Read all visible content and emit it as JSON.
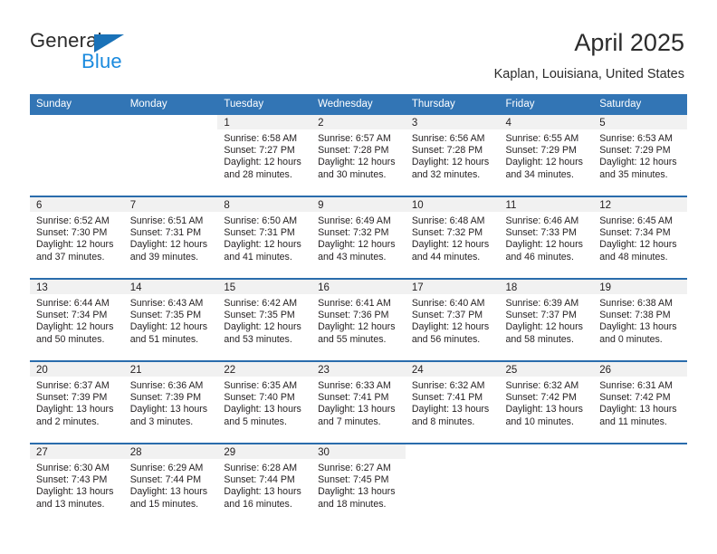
{
  "brand": {
    "name_part1": "General",
    "name_part2": "Blue",
    "triangle_color": "#1a72b8",
    "blue_color": "#1a8ade"
  },
  "header": {
    "title": "April 2025",
    "subtitle": "Kaplan, Louisiana, United States"
  },
  "theme": {
    "header_blue": "#3275b5",
    "row_divider_blue": "#2a6cac",
    "daynum_band": "#f1f1f1"
  },
  "weekday_headers": [
    "Sunday",
    "Monday",
    "Tuesday",
    "Wednesday",
    "Thursday",
    "Friday",
    "Saturday"
  ],
  "labels": {
    "sunrise_prefix": "Sunrise:",
    "sunset_prefix": "Sunset:",
    "daylight_prefix": "Daylight:"
  },
  "weeks": [
    [
      {
        "day": "",
        "blank": true
      },
      {
        "day": "",
        "blank": true
      },
      {
        "day": "1",
        "sunrise": "Sunrise: 6:58 AM",
        "sunset": "Sunset: 7:27 PM",
        "daylight_l1": "Daylight: 12 hours",
        "daylight_l2": "and 28 minutes."
      },
      {
        "day": "2",
        "sunrise": "Sunrise: 6:57 AM",
        "sunset": "Sunset: 7:28 PM",
        "daylight_l1": "Daylight: 12 hours",
        "daylight_l2": "and 30 minutes."
      },
      {
        "day": "3",
        "sunrise": "Sunrise: 6:56 AM",
        "sunset": "Sunset: 7:28 PM",
        "daylight_l1": "Daylight: 12 hours",
        "daylight_l2": "and 32 minutes."
      },
      {
        "day": "4",
        "sunrise": "Sunrise: 6:55 AM",
        "sunset": "Sunset: 7:29 PM",
        "daylight_l1": "Daylight: 12 hours",
        "daylight_l2": "and 34 minutes."
      },
      {
        "day": "5",
        "sunrise": "Sunrise: 6:53 AM",
        "sunset": "Sunset: 7:29 PM",
        "daylight_l1": "Daylight: 12 hours",
        "daylight_l2": "and 35 minutes."
      }
    ],
    [
      {
        "day": "6",
        "sunrise": "Sunrise: 6:52 AM",
        "sunset": "Sunset: 7:30 PM",
        "daylight_l1": "Daylight: 12 hours",
        "daylight_l2": "and 37 minutes."
      },
      {
        "day": "7",
        "sunrise": "Sunrise: 6:51 AM",
        "sunset": "Sunset: 7:31 PM",
        "daylight_l1": "Daylight: 12 hours",
        "daylight_l2": "and 39 minutes."
      },
      {
        "day": "8",
        "sunrise": "Sunrise: 6:50 AM",
        "sunset": "Sunset: 7:31 PM",
        "daylight_l1": "Daylight: 12 hours",
        "daylight_l2": "and 41 minutes."
      },
      {
        "day": "9",
        "sunrise": "Sunrise: 6:49 AM",
        "sunset": "Sunset: 7:32 PM",
        "daylight_l1": "Daylight: 12 hours",
        "daylight_l2": "and 43 minutes."
      },
      {
        "day": "10",
        "sunrise": "Sunrise: 6:48 AM",
        "sunset": "Sunset: 7:32 PM",
        "daylight_l1": "Daylight: 12 hours",
        "daylight_l2": "and 44 minutes."
      },
      {
        "day": "11",
        "sunrise": "Sunrise: 6:46 AM",
        "sunset": "Sunset: 7:33 PM",
        "daylight_l1": "Daylight: 12 hours",
        "daylight_l2": "and 46 minutes."
      },
      {
        "day": "12",
        "sunrise": "Sunrise: 6:45 AM",
        "sunset": "Sunset: 7:34 PM",
        "daylight_l1": "Daylight: 12 hours",
        "daylight_l2": "and 48 minutes."
      }
    ],
    [
      {
        "day": "13",
        "sunrise": "Sunrise: 6:44 AM",
        "sunset": "Sunset: 7:34 PM",
        "daylight_l1": "Daylight: 12 hours",
        "daylight_l2": "and 50 minutes."
      },
      {
        "day": "14",
        "sunrise": "Sunrise: 6:43 AM",
        "sunset": "Sunset: 7:35 PM",
        "daylight_l1": "Daylight: 12 hours",
        "daylight_l2": "and 51 minutes."
      },
      {
        "day": "15",
        "sunrise": "Sunrise: 6:42 AM",
        "sunset": "Sunset: 7:35 PM",
        "daylight_l1": "Daylight: 12 hours",
        "daylight_l2": "and 53 minutes."
      },
      {
        "day": "16",
        "sunrise": "Sunrise: 6:41 AM",
        "sunset": "Sunset: 7:36 PM",
        "daylight_l1": "Daylight: 12 hours",
        "daylight_l2": "and 55 minutes."
      },
      {
        "day": "17",
        "sunrise": "Sunrise: 6:40 AM",
        "sunset": "Sunset: 7:37 PM",
        "daylight_l1": "Daylight: 12 hours",
        "daylight_l2": "and 56 minutes."
      },
      {
        "day": "18",
        "sunrise": "Sunrise: 6:39 AM",
        "sunset": "Sunset: 7:37 PM",
        "daylight_l1": "Daylight: 12 hours",
        "daylight_l2": "and 58 minutes."
      },
      {
        "day": "19",
        "sunrise": "Sunrise: 6:38 AM",
        "sunset": "Sunset: 7:38 PM",
        "daylight_l1": "Daylight: 13 hours",
        "daylight_l2": "and 0 minutes."
      }
    ],
    [
      {
        "day": "20",
        "sunrise": "Sunrise: 6:37 AM",
        "sunset": "Sunset: 7:39 PM",
        "daylight_l1": "Daylight: 13 hours",
        "daylight_l2": "and 2 minutes."
      },
      {
        "day": "21",
        "sunrise": "Sunrise: 6:36 AM",
        "sunset": "Sunset: 7:39 PM",
        "daylight_l1": "Daylight: 13 hours",
        "daylight_l2": "and 3 minutes."
      },
      {
        "day": "22",
        "sunrise": "Sunrise: 6:35 AM",
        "sunset": "Sunset: 7:40 PM",
        "daylight_l1": "Daylight: 13 hours",
        "daylight_l2": "and 5 minutes."
      },
      {
        "day": "23",
        "sunrise": "Sunrise: 6:33 AM",
        "sunset": "Sunset: 7:41 PM",
        "daylight_l1": "Daylight: 13 hours",
        "daylight_l2": "and 7 minutes."
      },
      {
        "day": "24",
        "sunrise": "Sunrise: 6:32 AM",
        "sunset": "Sunset: 7:41 PM",
        "daylight_l1": "Daylight: 13 hours",
        "daylight_l2": "and 8 minutes."
      },
      {
        "day": "25",
        "sunrise": "Sunrise: 6:32 AM",
        "sunset": "Sunset: 7:42 PM",
        "daylight_l1": "Daylight: 13 hours",
        "daylight_l2": "and 10 minutes."
      },
      {
        "day": "26",
        "sunrise": "Sunrise: 6:31 AM",
        "sunset": "Sunset: 7:42 PM",
        "daylight_l1": "Daylight: 13 hours",
        "daylight_l2": "and 11 minutes."
      }
    ],
    [
      {
        "day": "27",
        "sunrise": "Sunrise: 6:30 AM",
        "sunset": "Sunset: 7:43 PM",
        "daylight_l1": "Daylight: 13 hours",
        "daylight_l2": "and 13 minutes."
      },
      {
        "day": "28",
        "sunrise": "Sunrise: 6:29 AM",
        "sunset": "Sunset: 7:44 PM",
        "daylight_l1": "Daylight: 13 hours",
        "daylight_l2": "and 15 minutes."
      },
      {
        "day": "29",
        "sunrise": "Sunrise: 6:28 AM",
        "sunset": "Sunset: 7:44 PM",
        "daylight_l1": "Daylight: 13 hours",
        "daylight_l2": "and 16 minutes."
      },
      {
        "day": "30",
        "sunrise": "Sunrise: 6:27 AM",
        "sunset": "Sunset: 7:45 PM",
        "daylight_l1": "Daylight: 13 hours",
        "daylight_l2": "and 18 minutes."
      },
      {
        "day": "",
        "blank": true
      },
      {
        "day": "",
        "blank": true
      },
      {
        "day": "",
        "blank": true
      }
    ]
  ]
}
